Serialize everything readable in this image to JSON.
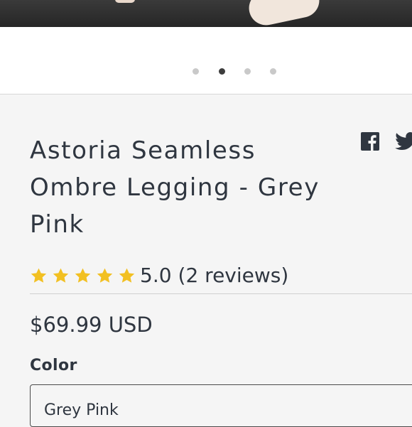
{
  "hero": {
    "image_alt": "product-photo"
  },
  "carousel": {
    "dot_count": 4,
    "active_index": 1
  },
  "product": {
    "title_line1": "Astoria Seamless",
    "title_line2": "Ombre Legging - Grey",
    "title_line3": "Pink",
    "rating_value": "5.0",
    "rating_count": "(2 reviews)",
    "stars": 5,
    "price": "$69.99 USD"
  },
  "share": {
    "facebook_icon": "facebook-icon",
    "twitter_icon": "twitter-icon"
  },
  "options": {
    "color_label": "Color",
    "color_selected": "Grey Pink"
  },
  "colors": {
    "star": "#f2c022",
    "text": "#2f3640",
    "background": "#f5f5f5"
  }
}
